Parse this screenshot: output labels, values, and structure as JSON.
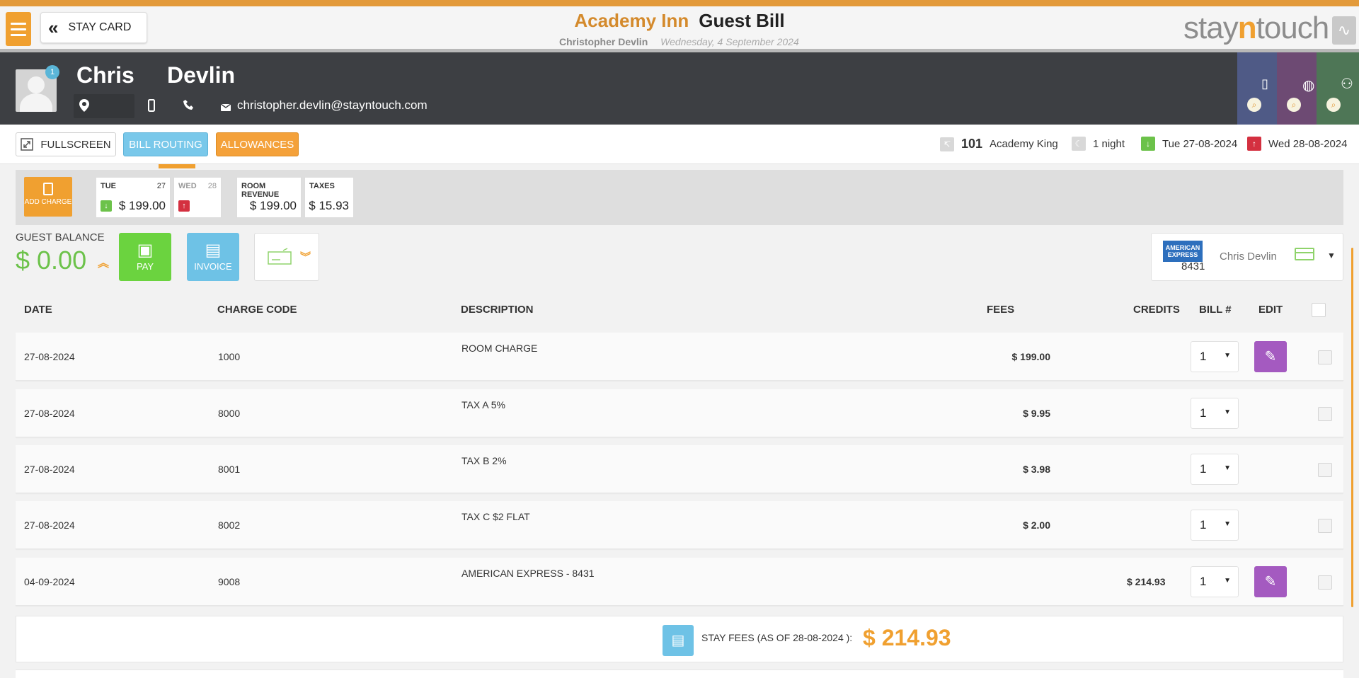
{
  "header": {
    "stay_card_label": "STAY CARD",
    "hotel_name": "Academy Inn",
    "page_title": "Guest Bill",
    "guest_full_name": "Christopher Devlin",
    "date_text": "Wednesday, 4 September 2024",
    "brand_left": "stay",
    "brand_mid": "n",
    "brand_right": "touch"
  },
  "guest": {
    "badge_count": "1",
    "first_name": "Chris",
    "last_name": "Devlin",
    "email": "christopher.devlin@stayntouch.com"
  },
  "actions": {
    "fullscreen_label": "FULLSCREEN",
    "bill_routing_label": "BILL ROUTING",
    "allowances_label": "ALLOWANCES"
  },
  "stay": {
    "room_number": "101",
    "room_type": "Academy King",
    "nights": "1 night",
    "arrival": "Tue 27-08-2024",
    "departure": "Wed 28-08-2024"
  },
  "calendar": {
    "add_charge_label": "ADD CHARGE",
    "days": [
      {
        "day": "TUE",
        "num": "27",
        "amount": "$ 199.00"
      },
      {
        "day": "WED",
        "num": "28",
        "amount": ""
      }
    ],
    "room_revenue_label": "ROOM REVENUE",
    "room_revenue": "$ 199.00",
    "taxes_label": "TAXES",
    "taxes": "$ 15.93"
  },
  "balance": {
    "label": "GUEST BALANCE",
    "amount": "$ 0.00",
    "pay_label": "PAY",
    "invoice_label": "INVOICE"
  },
  "payment_card": {
    "brand_text": "AMERICAN EXPRESS",
    "last4": "8431",
    "holder": "Chris Devlin"
  },
  "table": {
    "headers": {
      "date": "DATE",
      "charge_code": "CHARGE CODE",
      "description": "DESCRIPTION",
      "fees": "FEES",
      "credits": "CREDITS",
      "bill": "BILL #",
      "edit": "EDIT"
    },
    "rows": [
      {
        "date": "27-08-2024",
        "code": "1000",
        "desc": "ROOM CHARGE",
        "fees": "$ 199.00",
        "credits": "",
        "bill": "1"
      },
      {
        "date": "27-08-2024",
        "code": "8000",
        "desc": "TAX A 5%",
        "fees": "$ 9.95",
        "credits": "",
        "bill": "1"
      },
      {
        "date": "27-08-2024",
        "code": "8001",
        "desc": "TAX B 2%",
        "fees": "$ 3.98",
        "credits": "",
        "bill": "1"
      },
      {
        "date": "27-08-2024",
        "code": "8002",
        "desc": "TAX C $2 FLAT",
        "fees": "$ 2.00",
        "credits": "",
        "bill": "1"
      },
      {
        "date": "04-09-2024",
        "code": "9008",
        "desc": "AMERICAN EXPRESS - 8431",
        "fees": "",
        "credits": "$ 214.93",
        "bill": "1"
      }
    ]
  },
  "totals": {
    "label": "STAY FEES (AS OF  28-08-2024 ):",
    "amount": "$ 214.93"
  },
  "colors": {
    "accent": "#f0a030",
    "guest_bar": "#3d3f43",
    "balance_green": "#6cc24a",
    "edit_purple": "#a45ac0",
    "info_blue": "#6ec2e6"
  }
}
